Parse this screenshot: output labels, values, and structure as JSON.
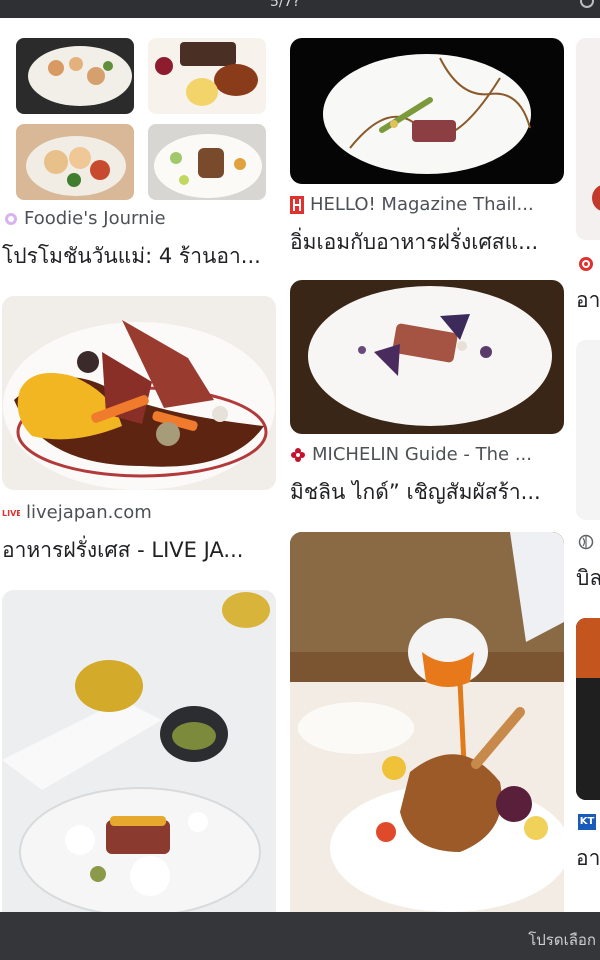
{
  "header": {
    "title": "5/7?"
  },
  "footer": {
    "hint": "โปรดเลือก"
  },
  "results": [
    {
      "source": "Foodie's Journie",
      "caption": "โปรโมชันวันแม่: 4 ร้านอา...",
      "icon": "foodie-icon"
    },
    {
      "source": "HELLO! Magazine Thail...",
      "caption": "อิ่มเอมกับอาหารฝรั่งเศสแ...",
      "icon": "hello-magazine-icon"
    },
    {
      "source": "livejapan.com",
      "caption": "อาหารฝรั่งเศส - LIVE JA...",
      "icon": "livejapan-icon"
    },
    {
      "source": "MICHELIN Guide - The ...",
      "caption": "มิชลิน ไกด์” เชิญสัมผัสร้า...",
      "icon": "michelin-icon"
    }
  ],
  "partial": {
    "right_caption_1": "อา",
    "right_caption_2": "บิล",
    "right_caption_3": "อา",
    "right_badge": "KT"
  },
  "colors": {
    "hello_red": "#e0312f",
    "michelin_red": "#c8102e",
    "foodie_purple": "#b276d8"
  }
}
